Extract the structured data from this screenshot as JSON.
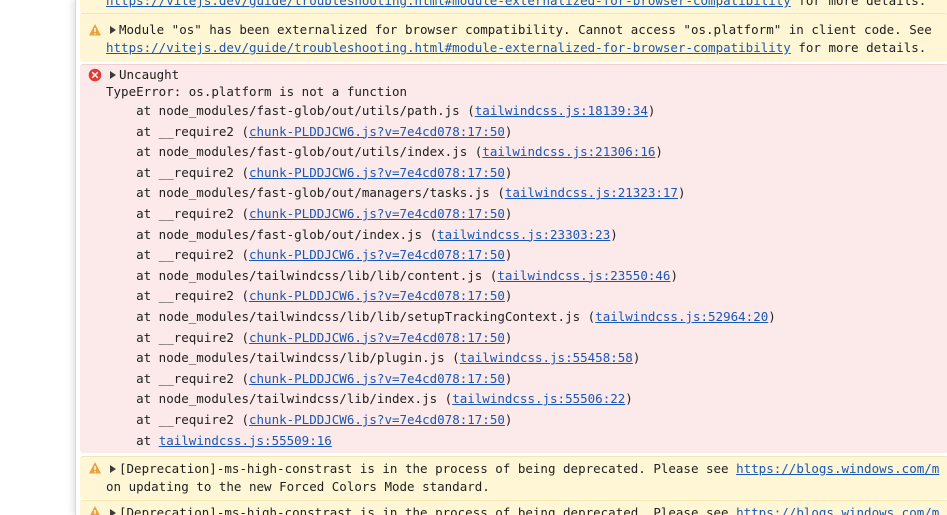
{
  "warn_top": {
    "link_cut": "https://vitejs.dev/guide/troubleshooting.html#module-externalized-for-browser-compatibility",
    "tail_cut": " for more details."
  },
  "warn_module": {
    "text": "Module \"os\" has been externalized for browser compatibility. Cannot access \"os.platform\" in client code. See",
    "link": "https://vitejs.dev/guide/troubleshooting.html#module-externalized-for-browser-compatibility",
    "tail": " for more details."
  },
  "error": {
    "title": "Uncaught",
    "message": "TypeError: os.platform is not a function",
    "stack": [
      {
        "text": "    at node_modules/fast-glob/out/utils/path.js (",
        "link": "tailwindcss.js:18139:34",
        "close": ")"
      },
      {
        "text": "    at __require2 (",
        "link": "chunk-PLDDJCW6.js?v=7e4cd078:17:50",
        "close": ")"
      },
      {
        "text": "    at node_modules/fast-glob/out/utils/index.js (",
        "link": "tailwindcss.js:21306:16",
        "close": ")"
      },
      {
        "text": "    at __require2 (",
        "link": "chunk-PLDDJCW6.js?v=7e4cd078:17:50",
        "close": ")"
      },
      {
        "text": "    at node_modules/fast-glob/out/managers/tasks.js (",
        "link": "tailwindcss.js:21323:17",
        "close": ")"
      },
      {
        "text": "    at __require2 (",
        "link": "chunk-PLDDJCW6.js?v=7e4cd078:17:50",
        "close": ")"
      },
      {
        "text": "    at node_modules/fast-glob/out/index.js (",
        "link": "tailwindcss.js:23303:23",
        "close": ")"
      },
      {
        "text": "    at __require2 (",
        "link": "chunk-PLDDJCW6.js?v=7e4cd078:17:50",
        "close": ")"
      },
      {
        "text": "    at node_modules/tailwindcss/lib/lib/content.js (",
        "link": "tailwindcss.js:23550:46",
        "close": ")"
      },
      {
        "text": "    at __require2 (",
        "link": "chunk-PLDDJCW6.js?v=7e4cd078:17:50",
        "close": ")"
      },
      {
        "text": "    at node_modules/tailwindcss/lib/lib/setupTrackingContext.js (",
        "link": "tailwindcss.js:52964:20",
        "close": ")"
      },
      {
        "text": "    at __require2 (",
        "link": "chunk-PLDDJCW6.js?v=7e4cd078:17:50",
        "close": ")"
      },
      {
        "text": "    at node_modules/tailwindcss/lib/plugin.js (",
        "link": "tailwindcss.js:55458:58",
        "close": ")"
      },
      {
        "text": "    at __require2 (",
        "link": "chunk-PLDDJCW6.js?v=7e4cd078:17:50",
        "close": ")"
      },
      {
        "text": "    at node_modules/tailwindcss/lib/index.js (",
        "link": "tailwindcss.js:55506:22",
        "close": ")"
      },
      {
        "text": "    at __require2 (",
        "link": "chunk-PLDDJCW6.js?v=7e4cd078:17:50",
        "close": ")"
      },
      {
        "text": "    at ",
        "link": "tailwindcss.js:55509:16",
        "close": ""
      }
    ]
  },
  "deprecation_1": {
    "text": "[Deprecation]-ms-high-constrast is in the process of being deprecated. Please see ",
    "link": "https://blogs.windows.com/m",
    "line2": "on updating to the new Forced Colors Mode standard."
  },
  "deprecation_2": {
    "text": "[Deprecation]-ms-high-constrast is in the process of being deprecated. Please see ",
    "link": "https://blogs.windows.com/m"
  },
  "colors": {
    "warning_bg": "#fef6d5",
    "error_bg": "#fce9e9",
    "link": "#1a58b5",
    "warning_icon": "#e8a33d",
    "error_icon": "#e53935"
  },
  "icons": {
    "warning": "warning-icon",
    "error": "error-icon",
    "expand": "expand-triangle-icon"
  }
}
